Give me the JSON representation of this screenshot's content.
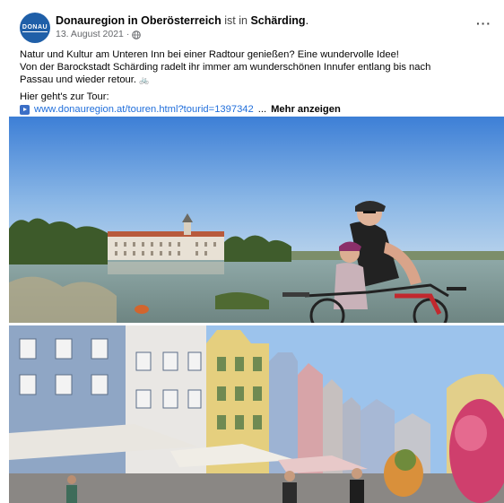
{
  "post": {
    "author": "Donauregion in Oberösterreich",
    "connector": "ist in",
    "location": "Schärding",
    "location_suffix": ".",
    "date": "13. August 2021",
    "date_separator": "·",
    "avatar_text": "DONAU",
    "more_options": "···",
    "text_line1": "Natur und Kultur am Unteren Inn bei einer Radtour genießen? Eine wundervolle Idee!",
    "text_line2": "Von der Barockstadt Schärding radelt ihr immer am wunderschönen Innufer entlang bis nach",
    "text_line3": "Passau und wieder retour.",
    "bike_emoji": "🚲",
    "tour_intro": "Hier geht's zur Tour:",
    "link_text": "www.donauregion.at/touren.html?tourid=1397342",
    "ellipsis": "...",
    "more_label": "Mehr anzeigen"
  },
  "icons": {
    "globe": "globe-icon",
    "link": "link-play-icon",
    "more": "more-options-icon"
  },
  "colors": {
    "link": "#216fdb",
    "avatar": "#1f5fa8",
    "muted": "#65676b"
  }
}
